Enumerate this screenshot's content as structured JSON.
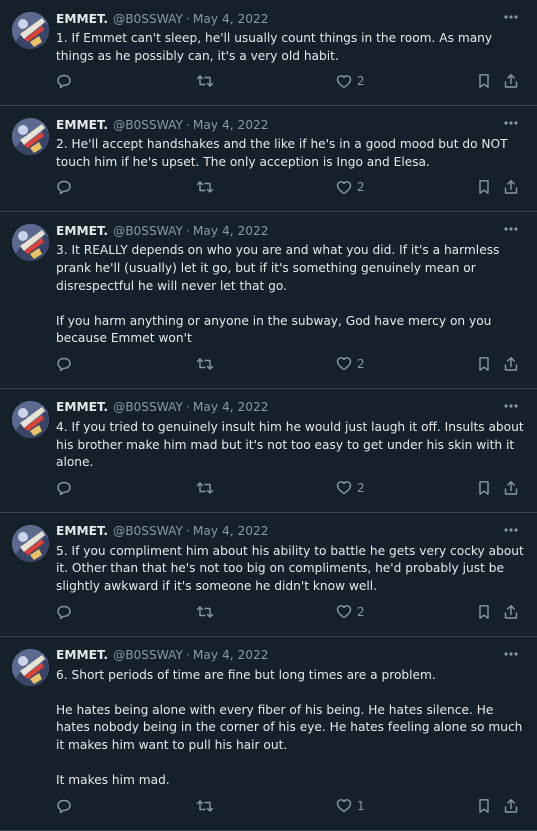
{
  "author": {
    "name": "EMMET.",
    "handle": "@B0SSWAY",
    "separator": "·"
  },
  "icons": {
    "reply": "reply-icon",
    "retweet": "retweet-icon",
    "like": "heart-icon",
    "bookmark": "bookmark-icon",
    "share": "share-icon",
    "more": "more-icon"
  },
  "colors": {
    "background": "#15202b",
    "text": "#e7e9ea",
    "muted": "#8b98a5",
    "divider": "#38444d"
  },
  "tweets": [
    {
      "date": "May 4, 2022",
      "text": "1. If Emmet can't sleep, he'll usually count things in the room. As many things as he possibly can, it's a very old habit.",
      "likes": "2"
    },
    {
      "date": "May 4, 2022",
      "text": "2. He'll accept handshakes and the like if he's in a good mood but do NOT touch him if he's upset. The only acception is Ingo and Elesa.",
      "likes": "2"
    },
    {
      "date": "May 4, 2022",
      "text": "3. It REALLY depends on who you are and what you did. If it's a harmless prank he'll (usually) let it go, but if it's something genuinely mean or disrespectful he will never let that go.\n\nIf you harm anything or anyone in the subway, God have mercy on you because Emmet won't",
      "likes": "2"
    },
    {
      "date": "May 4, 2022",
      "text": "4. If you tried to genuinely insult him he would just laugh it off. Insults about his brother make him mad but it's not too easy to get under his skin with it alone.",
      "likes": "2"
    },
    {
      "date": "May 4, 2022",
      "text": "5. If you compliment him about his ability to battle he gets very cocky about it. Other than that he's not too big on compliments, he'd probably just be slightly awkward if it's someone he didn't know well.",
      "likes": "2"
    },
    {
      "date": "May 4, 2022",
      "text": "6. Short periods of time are fine but long times are a problem.\n\nHe hates being alone with every fiber of his being. He hates silence. He hates nobody being in the corner of his eye. He hates feeling alone so much it makes him want to pull his hair out.\n\nIt makes him mad.",
      "likes": "1"
    }
  ]
}
